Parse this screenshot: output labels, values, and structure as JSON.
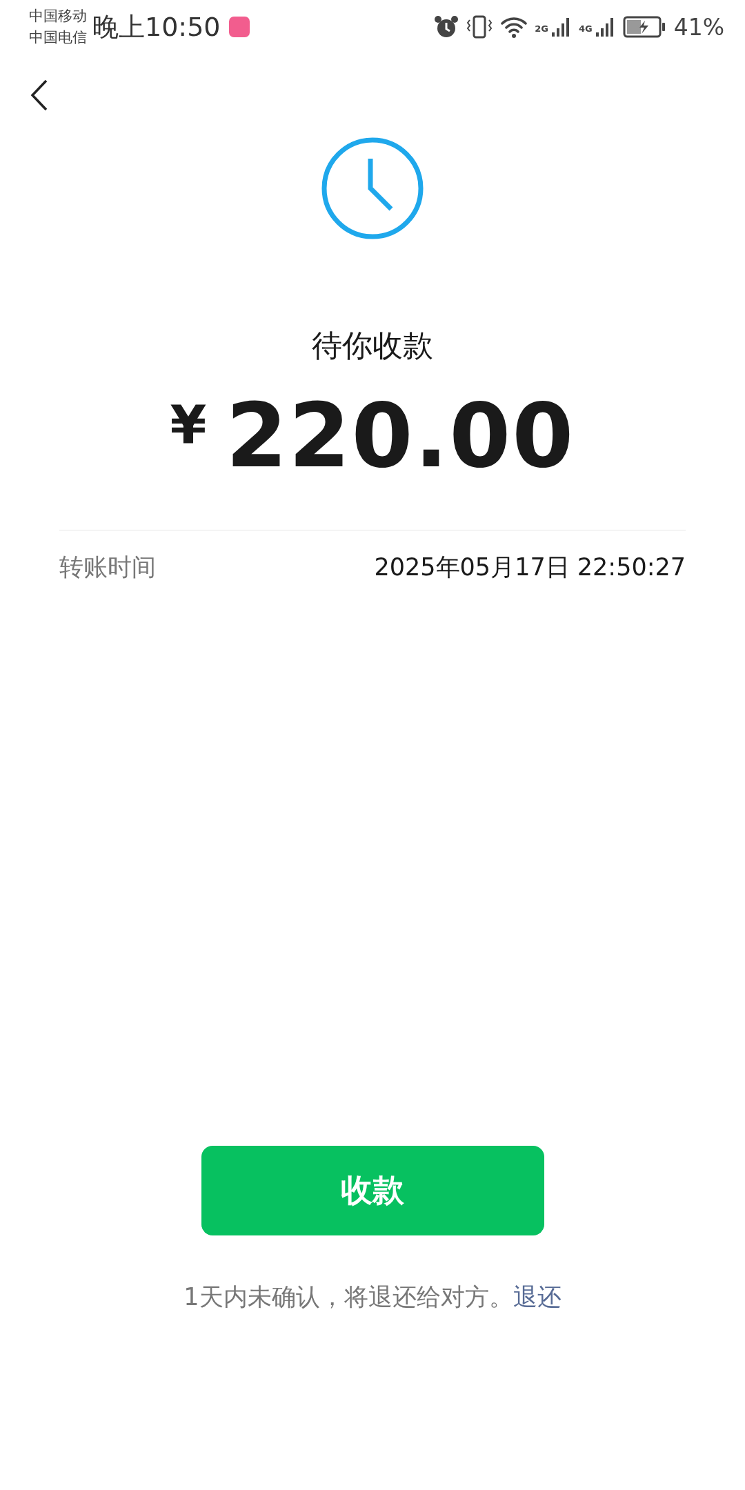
{
  "status_bar": {
    "carriers": [
      "中国移动",
      "中国电信"
    ],
    "time": "晚上10:50",
    "network_labels": [
      "2G",
      "4G"
    ],
    "battery": "41%"
  },
  "status": {
    "title": "待你收款",
    "currency": "¥",
    "amount": "220.00"
  },
  "details": [
    {
      "label": "转账时间",
      "value": "2025年05月17日 22:50:27"
    }
  ],
  "primary_button": "收款",
  "note": {
    "text": "1天内未确认，将退还给对方。",
    "link": "退还"
  }
}
